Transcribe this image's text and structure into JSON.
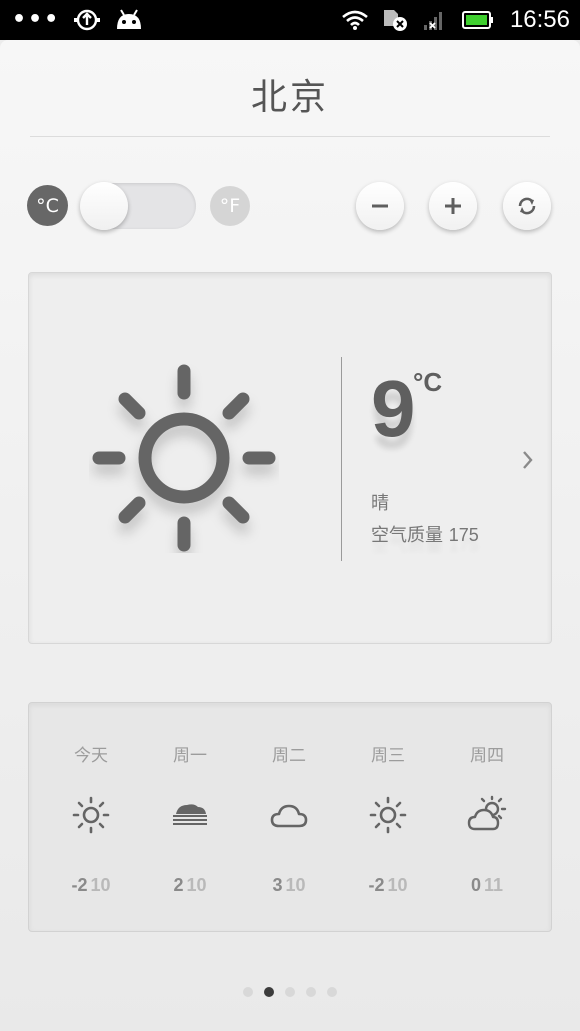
{
  "status_bar": {
    "time": "16:56",
    "left_icons": [
      "more-dots-icon",
      "usb-debug-icon",
      "android-icon"
    ],
    "right_icons": [
      "wifi-icon",
      "no-sim-icon",
      "signal-icon",
      "battery-icon"
    ]
  },
  "header": {
    "city": "北京"
  },
  "controls": {
    "unit_c": "°C",
    "unit_f": "°F",
    "selected_unit": "C",
    "buttons": [
      "minus-icon",
      "plus-icon",
      "refresh-icon"
    ]
  },
  "current": {
    "temp": "9",
    "unit": "°C",
    "condition": "晴",
    "aqi_label": "空气质量",
    "aqi_value": "175",
    "icon": "sun-icon"
  },
  "forecast": [
    {
      "day": "今天",
      "icon": "sun-icon",
      "low": "-2",
      "high": "10"
    },
    {
      "day": "周一",
      "icon": "haze-icon",
      "low": "2",
      "high": "10"
    },
    {
      "day": "周二",
      "icon": "cloud-icon",
      "low": "3",
      "high": "10"
    },
    {
      "day": "周三",
      "icon": "sun-icon",
      "low": "-2",
      "high": "10"
    },
    {
      "day": "周四",
      "icon": "partly-cloudy-icon",
      "low": "0",
      "high": "11"
    }
  ],
  "pager": {
    "count": 5,
    "active_index": 1
  },
  "colors": {
    "status_bar": "#000000",
    "icon_gray": "#656565",
    "active_unit": "#676767",
    "inactive_unit": "#d5d5d5",
    "background": "#ececec"
  }
}
